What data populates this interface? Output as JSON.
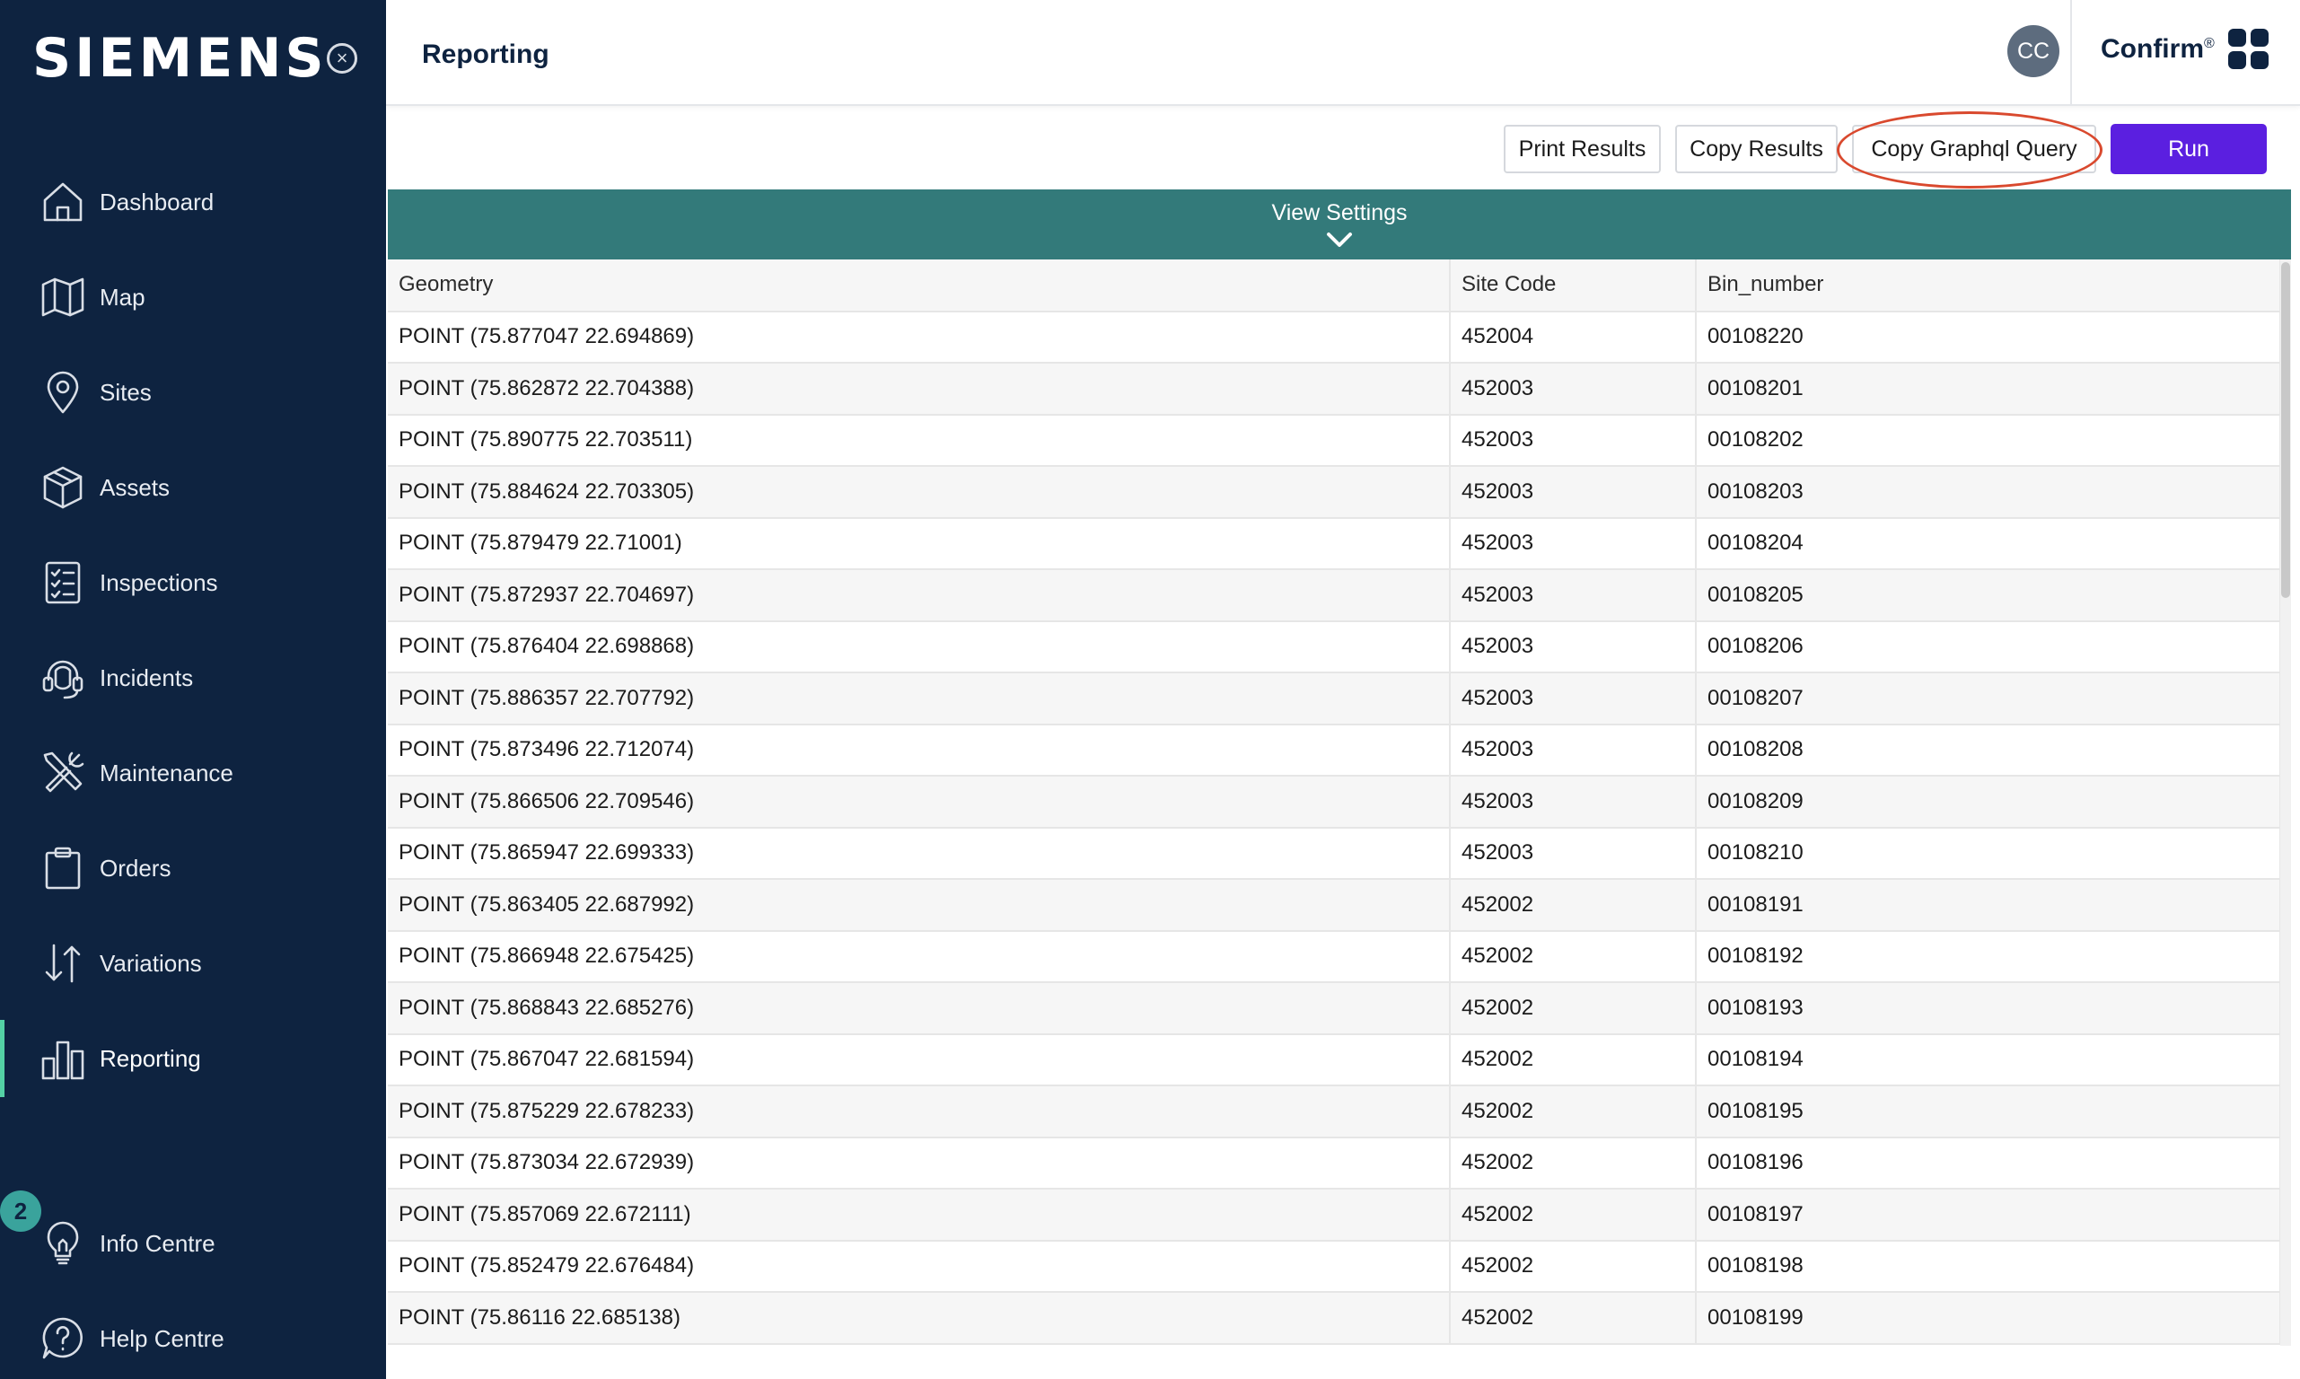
{
  "app": {
    "brand": "SIEMENS",
    "product": "Confirm",
    "product_mark": "®",
    "page_title": "Reporting",
    "user_initials": "CC"
  },
  "sidebar": {
    "items": [
      {
        "label": "Dashboard",
        "icon": "home-icon"
      },
      {
        "label": "Map",
        "icon": "map-icon"
      },
      {
        "label": "Sites",
        "icon": "location-pin-icon"
      },
      {
        "label": "Assets",
        "icon": "box-icon"
      },
      {
        "label": "Inspections",
        "icon": "checklist-icon"
      },
      {
        "label": "Incidents",
        "icon": "headset-icon"
      },
      {
        "label": "Maintenance",
        "icon": "tools-icon"
      },
      {
        "label": "Orders",
        "icon": "clipboard-icon"
      },
      {
        "label": "Variations",
        "icon": "up-down-arrows-icon"
      },
      {
        "label": "Reporting",
        "icon": "bar-chart-icon",
        "active": true
      }
    ],
    "footer_items": [
      {
        "label": "Info Centre",
        "icon": "lightbulb-icon"
      },
      {
        "label": "Help Centre",
        "icon": "question-bubble-icon"
      }
    ],
    "info_badge": "2"
  },
  "toolbar": {
    "print_label": "Print Results",
    "copy_label": "Copy Results",
    "copy_graphql_label": "Copy Graphql Query",
    "run_label": "Run",
    "run_color": "#5b1fe0",
    "highlight_color": "#d9492e"
  },
  "view_settings": {
    "label": "View Settings",
    "color": "#337a7a"
  },
  "table": {
    "headers": [
      "Geometry",
      "Site Code",
      "Bin_number"
    ],
    "rows": [
      [
        "POINT (75.877047 22.694869)",
        "452004",
        "00108220"
      ],
      [
        "POINT (75.862872 22.704388)",
        "452003",
        "00108201"
      ],
      [
        "POINT (75.890775 22.703511)",
        "452003",
        "00108202"
      ],
      [
        "POINT (75.884624 22.703305)",
        "452003",
        "00108203"
      ],
      [
        "POINT (75.879479 22.71001)",
        "452003",
        "00108204"
      ],
      [
        "POINT (75.872937 22.704697)",
        "452003",
        "00108205"
      ],
      [
        "POINT (75.876404 22.698868)",
        "452003",
        "00108206"
      ],
      [
        "POINT (75.886357 22.707792)",
        "452003",
        "00108207"
      ],
      [
        "POINT (75.873496 22.712074)",
        "452003",
        "00108208"
      ],
      [
        "POINT (75.866506 22.709546)",
        "452003",
        "00108209"
      ],
      [
        "POINT (75.865947 22.699333)",
        "452003",
        "00108210"
      ],
      [
        "POINT (75.863405 22.687992)",
        "452002",
        "00108191"
      ],
      [
        "POINT (75.866948 22.675425)",
        "452002",
        "00108192"
      ],
      [
        "POINT (75.868843 22.685276)",
        "452002",
        "00108193"
      ],
      [
        "POINT (75.867047 22.681594)",
        "452002",
        "00108194"
      ],
      [
        "POINT (75.875229 22.678233)",
        "452002",
        "00108195"
      ],
      [
        "POINT (75.873034 22.672939)",
        "452002",
        "00108196"
      ],
      [
        "POINT (75.857069 22.672111)",
        "452002",
        "00108197"
      ],
      [
        "POINT (75.852479 22.676484)",
        "452002",
        "00108198"
      ],
      [
        "POINT (75.86116 22.685138)",
        "452002",
        "00108199"
      ]
    ]
  }
}
